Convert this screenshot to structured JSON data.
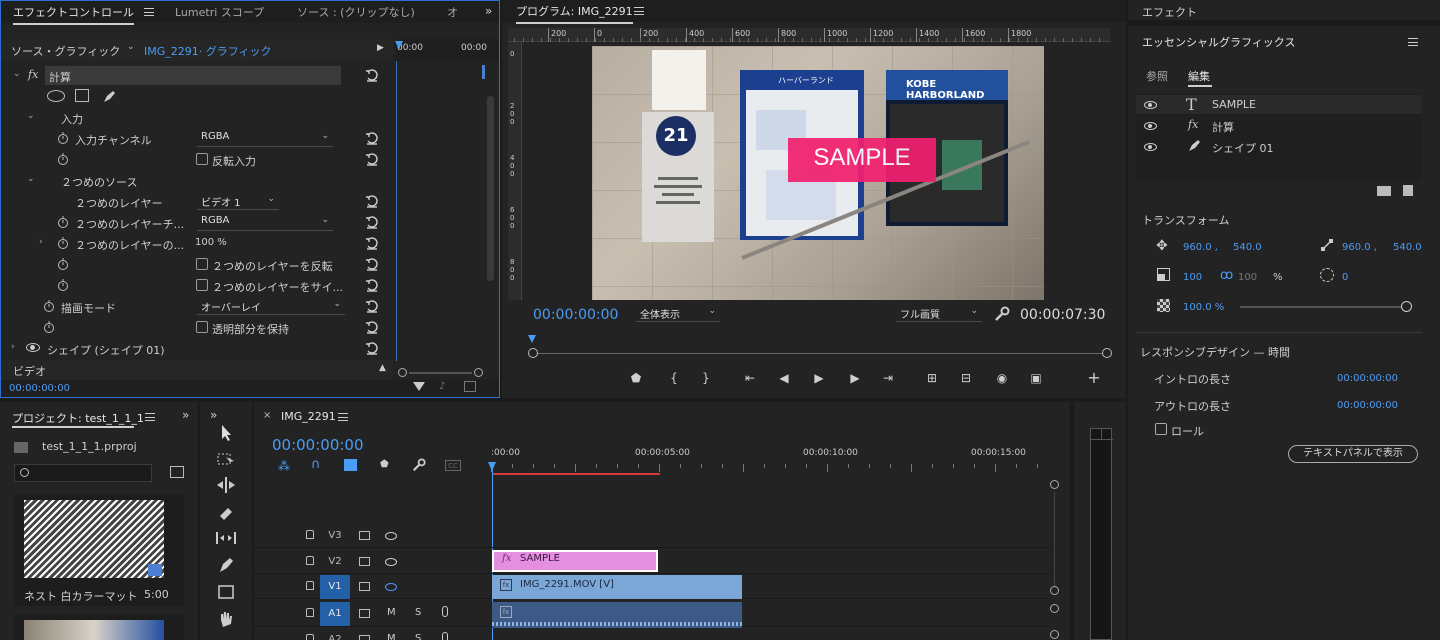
{
  "effect_controls": {
    "tab_label": "エフェクトコントロール",
    "menu_icon": "hamburger-icon",
    "tab_lumetri": "Lumetri スコープ",
    "tab_source": "ソース : (クリップなし)",
    "tab_more": "オ",
    "source_label": "ソース・グラフィック",
    "clip_label": "IMG_2291· グラフィック",
    "time_ruler_start": "00:00",
    "time_ruler_end": "00:00",
    "effect_name": "計算",
    "section_input": "入力",
    "input_channel_label": "入力チャンネル",
    "input_channel_value": "RGBA",
    "invert_input_label": "反転入力",
    "second_source_label": "２つめのソース",
    "second_layer_label": "２つめのレイヤー",
    "second_layer_value": "ビデオ 1",
    "second_layer_channel_label": "２つめのレイヤーチ...",
    "second_layer_channel_value": "RGBA",
    "second_layer_opacity_label": "２つめのレイヤーの...",
    "second_layer_opacity_value": "100 %",
    "invert_second_label": "２つめのレイヤーを反転",
    "stretch_second_label": "２つめのレイヤーをサイ...",
    "blend_mode_label": "描画モード",
    "blend_mode_value": "オーバーレイ",
    "preserve_transparency_label": "透明部分を保持",
    "shape_label": "シェイプ (シェイプ 01)",
    "video_label": "ビデオ",
    "timecode": "00:00:00:00"
  },
  "program_monitor": {
    "title": "プログラム: IMG_2291",
    "ruler_labels": [
      "200",
      "0",
      "200",
      "400",
      "600",
      "800",
      "1000",
      "1200",
      "1400",
      "1600",
      "1800"
    ],
    "vruler_labels": [
      "0",
      "2 0 0",
      "4 0 0",
      "6 0 0",
      "8 0 0"
    ],
    "timecode_current": "00:00:00:00",
    "zoom_value": "全体表示",
    "quality_value": "フル画質",
    "timecode_duration": "00:00:07:30",
    "overlay_text": "SAMPLE",
    "image_sign_number": "21",
    "image_sign_brand": "KOBE HARBORLAND",
    "image_sign_map_title": "ハーバーランド"
  },
  "essential_graphics": {
    "effects_title": "エフェクト",
    "panel_title": "エッセンシャルグラフィックス",
    "tab_browse": "参照",
    "tab_edit": "編集",
    "layers": [
      {
        "name": "SAMPLE",
        "icon": "text-T-icon"
      },
      {
        "name": "計算",
        "icon": "fx-icon"
      },
      {
        "name": "シェイプ 01",
        "icon": "pen-icon"
      }
    ],
    "transform_title": "トランスフォーム",
    "position_x": "960.0 ,",
    "position_y": "540.0",
    "anchor_x": "960.0 ,",
    "anchor_y": "540.0",
    "scale_w": "100",
    "scale_h": "100",
    "scale_unit": "%",
    "rotation": "0",
    "opacity": "100.0 %",
    "responsive_title": "レスポンシブデザイン — 時間",
    "intro_label": "イントロの長さ",
    "intro_value": "00:00:00:00",
    "outro_label": "アウトロの長さ",
    "outro_value": "00:00:00:00",
    "roll_label": "ロール",
    "text_panel_button": "テキストパネルで表示"
  },
  "project": {
    "tab_label": "プロジェクト: test_1_1_1",
    "file_name": "test_1_1_1.prproj",
    "item1_name": "ネスト 白カラーマット",
    "item1_duration": "5:00"
  },
  "timeline": {
    "sequence_name": "IMG_2291",
    "timecode": "00:00:00:00",
    "ruler_labels": [
      ":00:00",
      "00:00:05:00",
      "00:00:10:00",
      "00:00:15:00"
    ],
    "tracks": [
      {
        "id": "V3"
      },
      {
        "id": "V2"
      },
      {
        "id": "V1"
      },
      {
        "id": "A1",
        "m": "M",
        "s": "S"
      },
      {
        "id": "A2",
        "m": "M",
        "s": "S"
      }
    ],
    "clip_sample": "SAMPLE",
    "clip_video": "IMG_2291.MOV [V]"
  },
  "colors": {
    "accent_blue": "#4b9cf5",
    "clip_pink": "#e48fe0",
    "clip_blue": "#7ba7d6",
    "sample_magenta": "#f2206f"
  }
}
